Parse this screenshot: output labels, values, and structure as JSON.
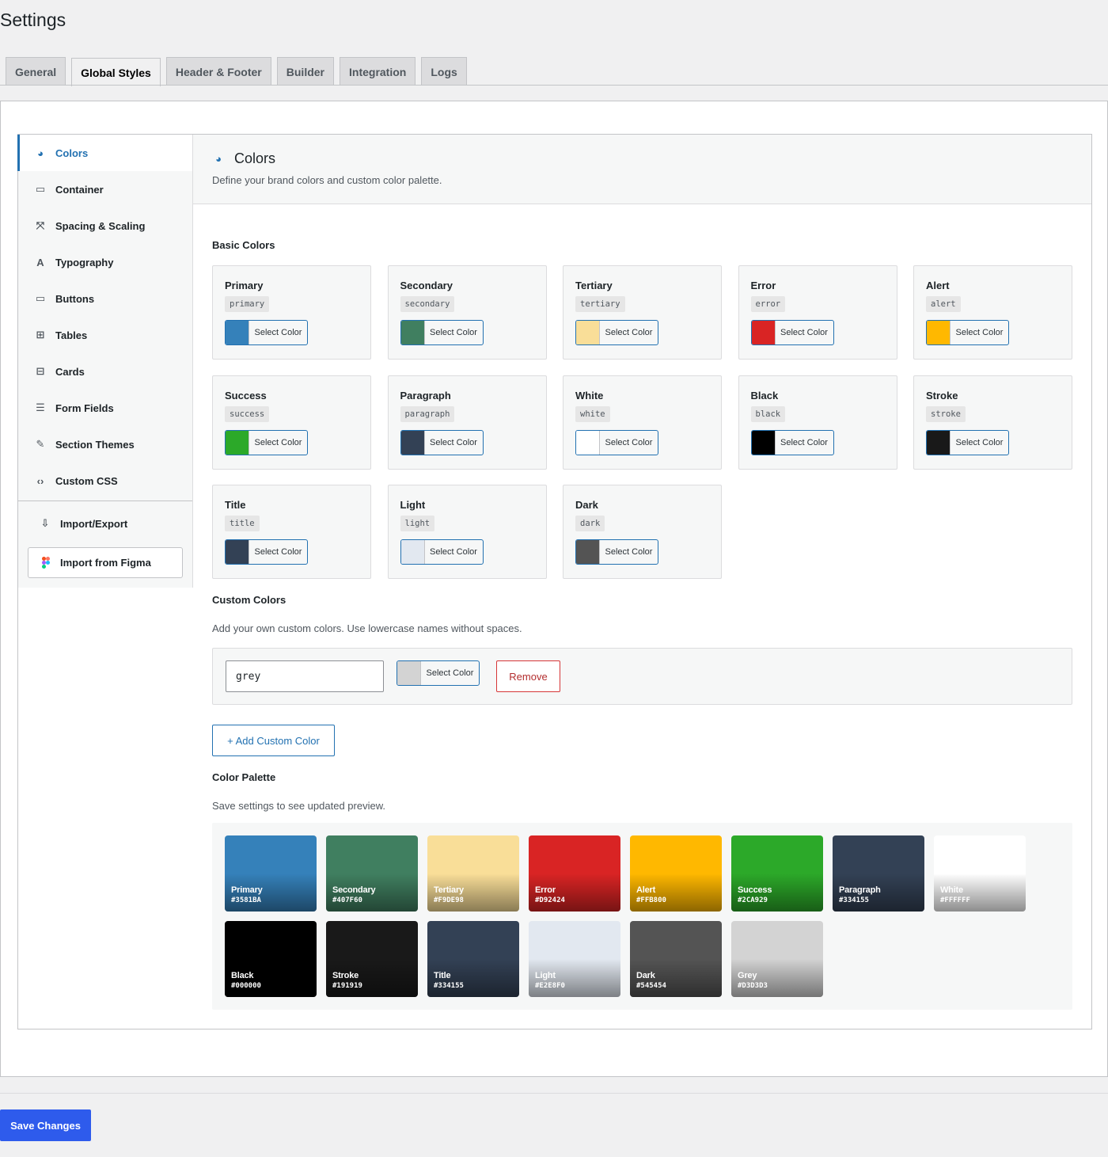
{
  "page": {
    "title": "Settings"
  },
  "tabs": [
    {
      "label": "General"
    },
    {
      "label": "Global Styles"
    },
    {
      "label": "Header & Footer"
    },
    {
      "label": "Builder"
    },
    {
      "label": "Integration"
    },
    {
      "label": "Logs"
    }
  ],
  "sidebar": {
    "items": [
      {
        "label": "Colors",
        "icon": "palette-icon",
        "glyph": "◕"
      },
      {
        "label": "Container",
        "icon": "container-icon",
        "glyph": "▭"
      },
      {
        "label": "Spacing & Scaling",
        "icon": "scaling-icon",
        "glyph": "⤧"
      },
      {
        "label": "Typography",
        "icon": "typography-icon",
        "glyph": "A"
      },
      {
        "label": "Buttons",
        "icon": "button-icon",
        "glyph": "▭"
      },
      {
        "label": "Tables",
        "icon": "table-icon",
        "glyph": "⊞"
      },
      {
        "label": "Cards",
        "icon": "cards-icon",
        "glyph": "⊟"
      },
      {
        "label": "Form Fields",
        "icon": "form-icon",
        "glyph": "☰"
      },
      {
        "label": "Section Themes",
        "icon": "brush-icon",
        "glyph": "✎"
      },
      {
        "label": "Custom CSS",
        "icon": "code-icon",
        "glyph": "‹›"
      }
    ],
    "import_export": {
      "label": "Import/Export",
      "icon": "import-export-icon",
      "glyph": "⇩"
    },
    "figma": {
      "label": "Import from Figma",
      "icon": "figma-icon"
    }
  },
  "main": {
    "title": "Colors",
    "subtitle": "Define your brand colors and custom color palette.",
    "basic_label": "Basic Colors",
    "select_label": "Select Color",
    "basic_colors": [
      {
        "name": "Primary",
        "slug": "primary",
        "color": "#3581BA"
      },
      {
        "name": "Secondary",
        "slug": "secondary",
        "color": "#407F60"
      },
      {
        "name": "Tertiary",
        "slug": "tertiary",
        "color": "#F9DE98"
      },
      {
        "name": "Error",
        "slug": "error",
        "color": "#D92424"
      },
      {
        "name": "Alert",
        "slug": "alert",
        "color": "#FFB800"
      },
      {
        "name": "Success",
        "slug": "success",
        "color": "#2CA929"
      },
      {
        "name": "Paragraph",
        "slug": "paragraph",
        "color": "#334155"
      },
      {
        "name": "White",
        "slug": "white",
        "color": "#FFFFFF"
      },
      {
        "name": "Black",
        "slug": "black",
        "color": "#000000"
      },
      {
        "name": "Stroke",
        "slug": "stroke",
        "color": "#191919"
      },
      {
        "name": "Title",
        "slug": "title",
        "color": "#334155"
      },
      {
        "name": "Light",
        "slug": "light",
        "color": "#E2E8F0"
      },
      {
        "name": "Dark",
        "slug": "dark",
        "color": "#545454"
      }
    ],
    "custom_label": "Custom Colors",
    "custom_help": "Add your own custom colors. Use lowercase names without spaces.",
    "custom_colors": [
      {
        "name": "grey",
        "color": "#D3D3D3"
      }
    ],
    "remove_label": "Remove",
    "add_label": "+ Add Custom Color",
    "palette_label": "Color Palette",
    "palette_help": "Save settings to see updated preview.",
    "palette": [
      {
        "name": "Primary",
        "hex": "#3581BA"
      },
      {
        "name": "Secondary",
        "hex": "#407F60"
      },
      {
        "name": "Tertiary",
        "hex": "#F9DE98"
      },
      {
        "name": "Error",
        "hex": "#D92424"
      },
      {
        "name": "Alert",
        "hex": "#FFB800"
      },
      {
        "name": "Success",
        "hex": "#2CA929"
      },
      {
        "name": "Paragraph",
        "hex": "#334155"
      },
      {
        "name": "White",
        "hex": "#FFFFFF"
      },
      {
        "name": "Black",
        "hex": "#000000"
      },
      {
        "name": "Stroke",
        "hex": "#191919"
      },
      {
        "name": "Title",
        "hex": "#334155"
      },
      {
        "name": "Light",
        "hex": "#E2E8F0"
      },
      {
        "name": "Dark",
        "hex": "#545454"
      },
      {
        "name": "Grey",
        "hex": "#D3D3D3"
      }
    ]
  },
  "footer": {
    "save_label": "Save Changes"
  },
  "colors": {
    "accent": "#2271b1",
    "save": "#2e5bec",
    "danger": "#d63638"
  }
}
